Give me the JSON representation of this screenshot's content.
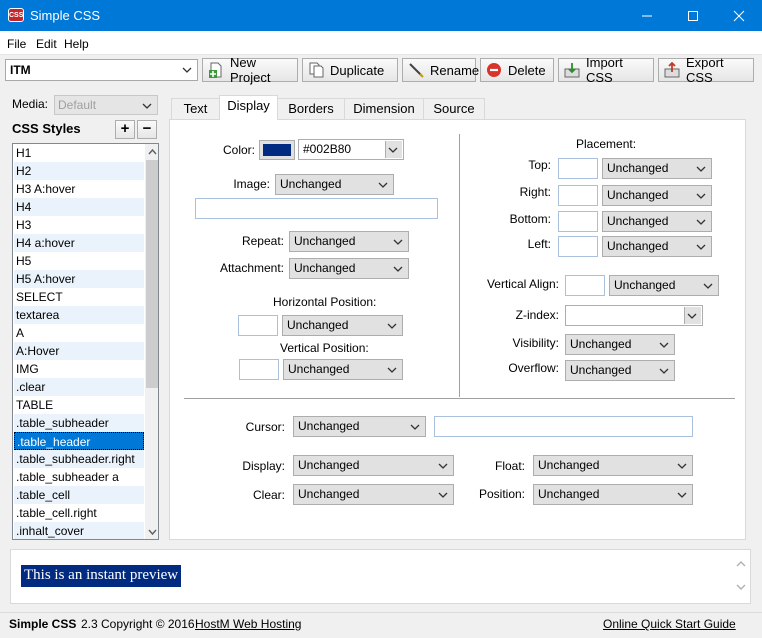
{
  "window": {
    "app_icon_text": "CSS",
    "title": "Simple CSS"
  },
  "menu": [
    "File",
    "Edit",
    "Help"
  ],
  "toolbar": {
    "project": "ITM",
    "buttons": [
      "New Project",
      "Duplicate",
      "Rename",
      "Delete",
      "Import CSS",
      "Export CSS"
    ]
  },
  "sidebar": {
    "media_label": "Media:",
    "media_value": "Default",
    "styles_label": "CSS Styles",
    "add_label": "+",
    "remove_label": "−",
    "styles": [
      "H1",
      "H2",
      "H3 A:hover",
      "H4",
      "H3",
      "H4 a:hover",
      "H5",
      "H5 A:hover",
      "SELECT",
      "textarea",
      "A",
      "A:Hover",
      "IMG",
      ".clear",
      "TABLE",
      ".table_subheader",
      ".table_header",
      ".table_subheader.right",
      ".table_subheader a",
      ".table_cell",
      ".table_cell.right",
      ".inhalt_cover"
    ],
    "selected_style": ".table_header"
  },
  "tabs": [
    "Text",
    "Display",
    "Borders",
    "Dimension",
    "Source"
  ],
  "active_tab": "Display",
  "display": {
    "color_label": "Color:",
    "color_value": "#002B80",
    "color_swatch": "#002b80",
    "image_label": "Image:",
    "image_value": "Unchanged",
    "repeat_label": "Repeat:",
    "repeat_value": "Unchanged",
    "attachment_label": "Attachment:",
    "attachment_value": "Unchanged",
    "hpos_label": "Horizontal Position:",
    "hpos_value": "Unchanged",
    "vpos_label": "Vertical Position:",
    "vpos_value": "Unchanged",
    "placement_label": "Placement:",
    "top_label": "Top:",
    "top_value": "Unchanged",
    "right_label": "Right:",
    "right_value": "Unchanged",
    "bottom_label": "Bottom:",
    "bottom_value": "Unchanged",
    "left_label": "Left:",
    "left_value": "Unchanged",
    "valign_label": "Vertical Align:",
    "valign_value": "Unchanged",
    "zindex_label": "Z-index:",
    "visibility_label": "Visibility:",
    "visibility_value": "Unchanged",
    "overflow_label": "Overflow:",
    "overflow_value": "Unchanged",
    "cursor_label": "Cursor:",
    "cursor_value": "Unchanged",
    "display_label": "Display:",
    "display_value": "Unchanged",
    "clear_label": "Clear:",
    "clear_value": "Unchanged",
    "float_label": "Float:",
    "float_value": "Unchanged",
    "position_label": "Position:",
    "position_value": "Unchanged"
  },
  "preview": {
    "text": "This is an instant preview"
  },
  "status": {
    "app": "Simple CSS",
    "copyright": "2.3 Copyright © 2016",
    "host_link": "HostM Web Hosting",
    "guide_link": "Online Quick Start Guide"
  }
}
